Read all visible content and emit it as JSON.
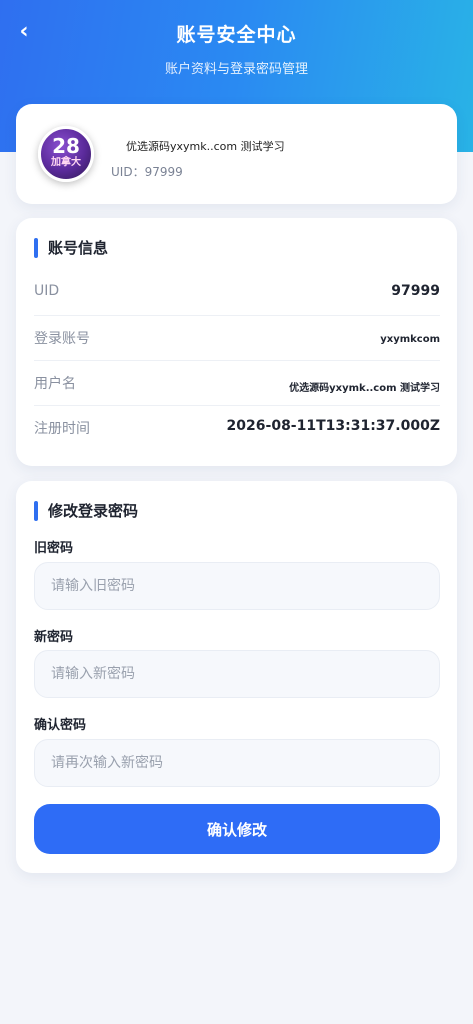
{
  "header": {
    "title": "账号安全中心",
    "subtitle": "账户资料与登录密码管理",
    "back_icon": "‹"
  },
  "profile": {
    "avatar_text_1": "28",
    "avatar_text_2": "加拿大",
    "name": "优选源码yxymk..com 测试学习",
    "uid_text": "UID：97999"
  },
  "account_info": {
    "title": "账号信息",
    "rows": [
      {
        "label": "UID",
        "value": "97999"
      },
      {
        "label": "登录账号",
        "value": "yxymkcom"
      },
      {
        "label": "用户名",
        "value": "优选源码yxymk..com 测试学习"
      },
      {
        "label": "注册时间",
        "value": "2026-08-11T13:31:37.000Z"
      }
    ]
  },
  "password_form": {
    "title": "修改登录密码",
    "old_label": "旧密码",
    "old_placeholder": "请输入旧密码",
    "new_label": "新密码",
    "new_placeholder": "请输入新密码",
    "confirm_label": "确认密码",
    "confirm_placeholder": "请再次输入新密码",
    "submit_label": "确认修改"
  },
  "colors": {
    "accent": "#2e6cf6",
    "header_gradient_start": "#2f6ff0",
    "header_gradient_end": "#29b3e6",
    "background": "#f3f5fa"
  }
}
